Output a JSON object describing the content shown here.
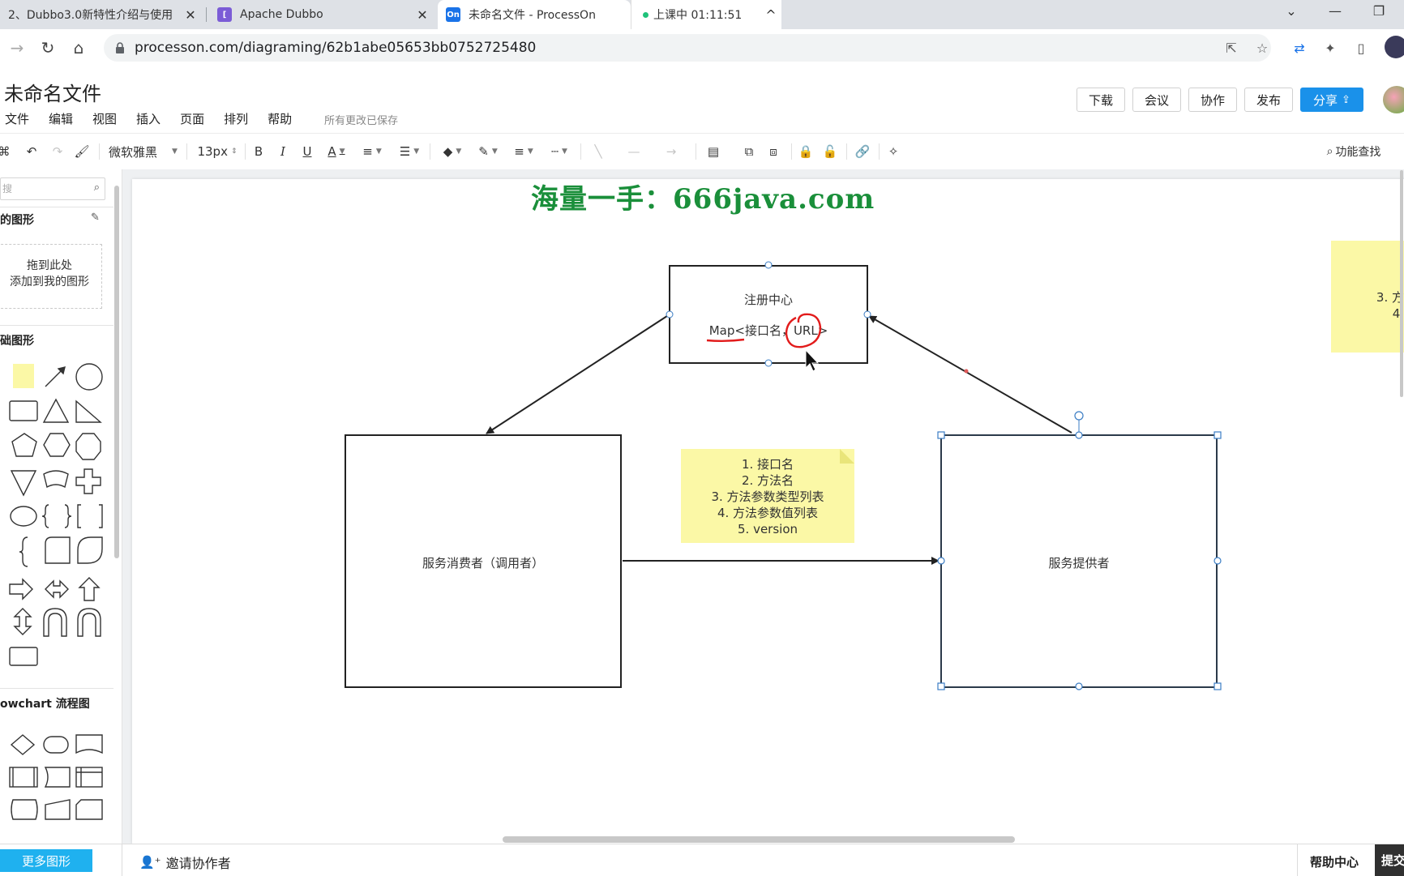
{
  "browser": {
    "tabs": [
      {
        "title": "2、Dubbo3.0新特性介绍与使用",
        "close": "✕"
      },
      {
        "title": "Apache Dubbo",
        "close": "✕"
      },
      {
        "title": "未命名文件 - ProcessOn",
        "favicon": "On"
      },
      {
        "title": "上课中 01:11:51",
        "chevron": "^"
      }
    ],
    "url": "processon.com/diagraming/62b1abe05653bb0752725480",
    "accent": "#1a91ea"
  },
  "app": {
    "doc_title": "未命名文件",
    "menu": [
      "文件",
      "编辑",
      "视图",
      "插入",
      "页面",
      "排列",
      "帮助"
    ],
    "save_status": "所有更改已保存",
    "header_buttons": {
      "download": "下载",
      "meeting": "会议",
      "collab": "协作",
      "publish": "发布",
      "share": "分享"
    }
  },
  "toolbar": {
    "font_family": "微软雅黑",
    "font_size": "13px",
    "bold": "B",
    "italic": "I",
    "underline": "U",
    "font_color": "A",
    "feature_search": "功能查找"
  },
  "left_panel": {
    "search_placeholder": "搜",
    "my_shapes_title": "的图形",
    "drop_hint_line1": "拖到此处",
    "drop_hint_line2": "添加到我的图形",
    "basic_shapes_title": "础图形",
    "flowchart_title": "owchart 流程图",
    "more_shapes": "更多图形"
  },
  "canvas": {
    "watermark": "海量一手：666java.com",
    "registry": {
      "title": "注册中心",
      "map_line_a": "Map",
      "map_line_b": "<接口名，",
      "map_line_c": "URL>"
    },
    "consumer": {
      "label": "服务消费者（调用者）"
    },
    "provider": {
      "label": "服务提供者"
    },
    "note_items": [
      "1. 接口名",
      "2. 方法名",
      "3. 方法参数类型列表",
      "4. 方法参数值列表",
      "5. version"
    ],
    "edge_note_line1": "3. 方",
    "edge_note_line2": "4."
  },
  "bottom": {
    "invite": "邀请协作者",
    "help_center": "帮助中心",
    "submit": "提交"
  }
}
